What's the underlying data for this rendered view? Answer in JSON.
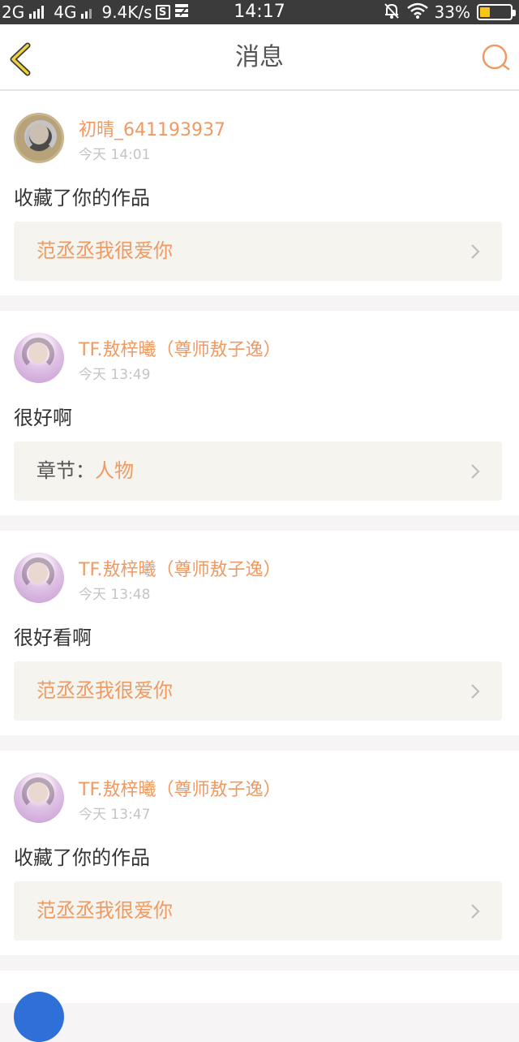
{
  "status_bar": {
    "net1": "2G",
    "net2": "4G",
    "speed": "9.4K/s",
    "s_badge": "S",
    "time": "14:17",
    "battery": "33%",
    "battery_level": 0.33,
    "accent": "#f5c518"
  },
  "header": {
    "title": "消息",
    "back_icon": "chevron-left-icon",
    "search_icon": "search-icon",
    "accent": "#ef9a63"
  },
  "messages": [
    {
      "user": "初晴_641193937",
      "time": "今天 14:01",
      "text": "收藏了你的作品",
      "ref_prefix": "",
      "ref_title": "范丞丞我很爱你",
      "avatar": "avatar-gold"
    },
    {
      "user": "TF.敖梓曦（尊师敖子逸）",
      "time": "今天 13:49",
      "text": "很好啊",
      "ref_prefix": "章节：",
      "ref_title": "人物",
      "avatar": "avatar-pink"
    },
    {
      "user": "TF.敖梓曦（尊师敖子逸）",
      "time": "今天 13:48",
      "text": "很好看啊",
      "ref_prefix": "",
      "ref_title": "范丞丞我很爱你",
      "avatar": "avatar-pink"
    },
    {
      "user": "TF.敖梓曦（尊师敖子逸）",
      "time": "今天 13:47",
      "text": "收藏了你的作品",
      "ref_prefix": "",
      "ref_title": "范丞丞我很爱你",
      "avatar": "avatar-pink"
    }
  ]
}
